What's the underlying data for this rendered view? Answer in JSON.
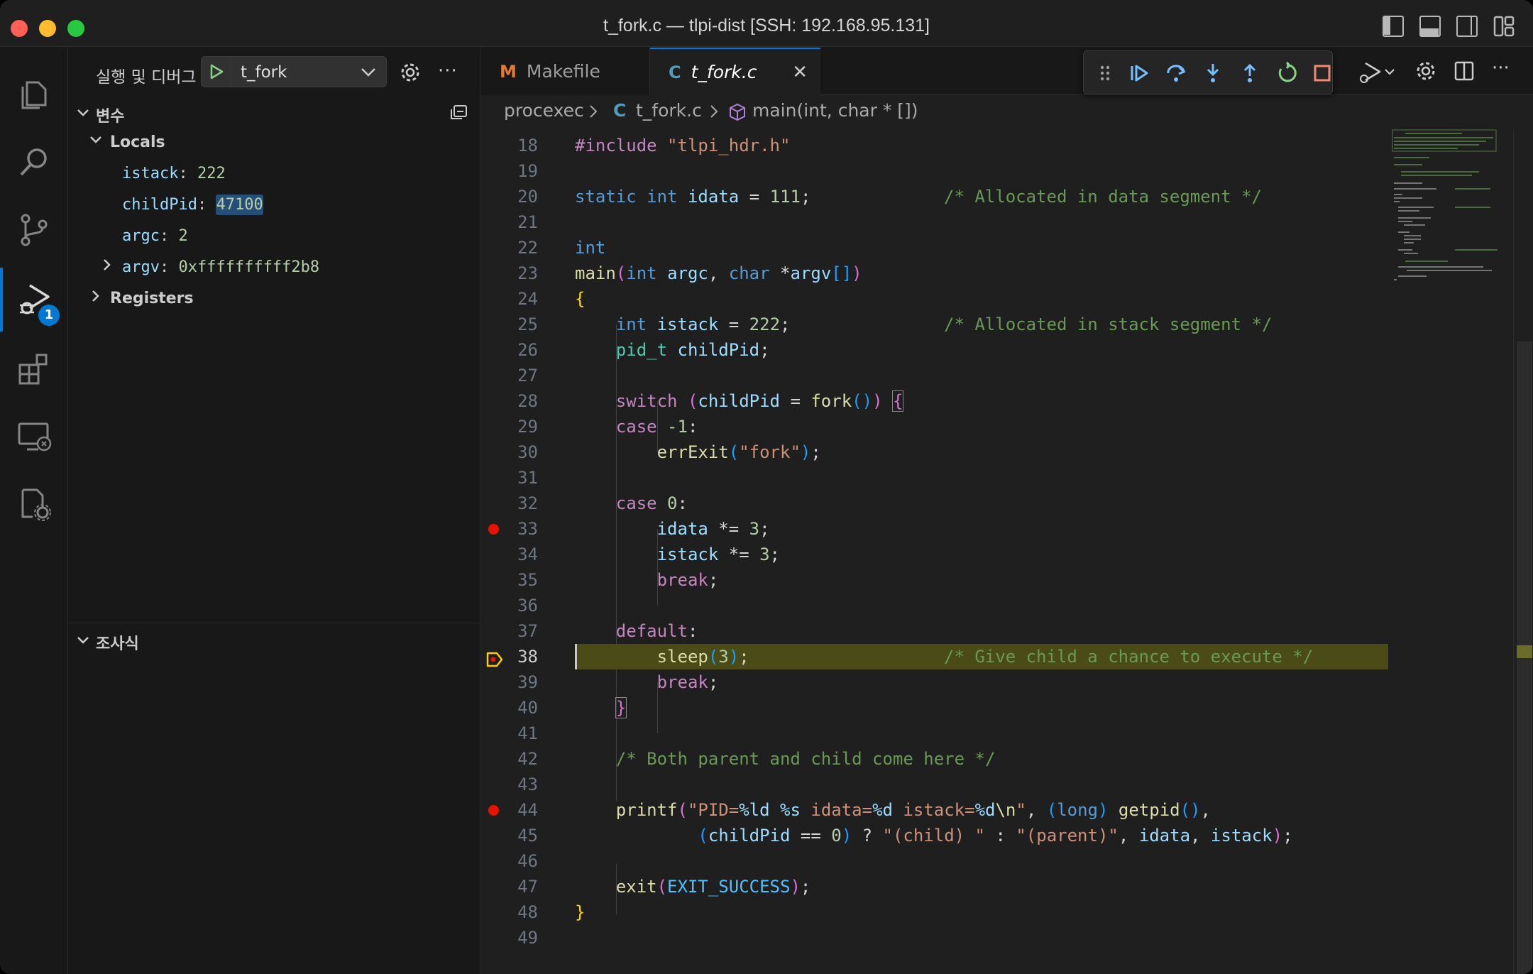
{
  "window": {
    "title": "t_fork.c — tlpi-dist [SSH: 192.168.95.131]"
  },
  "colors": {
    "accent": "#0078d4",
    "breakpoint": "#e51400",
    "current_line": "#4b4b18"
  },
  "activity_bar": {
    "items": [
      {
        "name": "explorer",
        "icon": "files-icon"
      },
      {
        "name": "search",
        "icon": "search-icon"
      },
      {
        "name": "source-control",
        "icon": "source-control-icon"
      },
      {
        "name": "run-and-debug",
        "icon": "debug-icon",
        "badge": "1",
        "active": true
      },
      {
        "name": "extensions",
        "icon": "extensions-icon"
      },
      {
        "name": "remote-explorer",
        "icon": "remote-explorer-icon"
      },
      {
        "name": "remote-settings",
        "icon": "remote-settings-icon"
      }
    ]
  },
  "sidebar": {
    "title": "실행 및 디버그",
    "run_config": "t_fork",
    "more_label": "···",
    "variables": {
      "title": "변수",
      "locals_label": "Locals",
      "locals": [
        {
          "name": "istack",
          "value": "222"
        },
        {
          "name": "childPid",
          "value": "47100"
        },
        {
          "name": "argc",
          "value": "2"
        },
        {
          "name": "argv",
          "value": "0xffffffffff2b8"
        }
      ],
      "registers_label": "Registers"
    },
    "watch": {
      "title": "조사식"
    }
  },
  "editor": {
    "tabs": [
      {
        "icon_label": "M",
        "label": "Makefile"
      },
      {
        "icon_label": "C",
        "label": "t_fork.c",
        "active": true
      }
    ],
    "close_label": "✕",
    "breadcrumbs": {
      "folder": "procexec",
      "file_icon": "C",
      "file": "t_fork.c",
      "symbol": "main(int, char * [])"
    },
    "debug_toolbar": [
      "drag-handle-icon",
      "continue-icon",
      "step-over-icon",
      "step-into-icon",
      "step-out-icon",
      "restart-icon",
      "stop-icon"
    ],
    "current_line": 38,
    "breakpoints": [
      33,
      44
    ],
    "line_numbers": [
      "18",
      "19",
      "20",
      "21",
      "22",
      "23",
      "24",
      "25",
      "26",
      "27",
      "28",
      "29",
      "30",
      "31",
      "32",
      "33",
      "34",
      "35",
      "36",
      "37",
      "38",
      "39",
      "40",
      "41",
      "42",
      "43",
      "44",
      "45",
      "46",
      "47",
      "48",
      "49"
    ],
    "code": {
      "l18_pp": "#include",
      "l18_str": "\"tlpi_hdr.h\"",
      "l20_kw1": "static",
      "l20_kw2": "int",
      "l20_var": "idata",
      "l20_op": " = ",
      "l20_num": "111",
      "l20_semi": ";",
      "l20_cmt": "/* Allocated in data segment */",
      "l22_kw": "int",
      "l23_fn": "main",
      "l23_kw1": "int",
      "l23_v1": "argc",
      "l23_kw2": "char",
      "l23_v2": "argv",
      "l24_brace": "{",
      "l25_kw": "int",
      "l25_var": "istack",
      "l25_num": "222",
      "l25_cmt": "/* Allocated in stack segment */",
      "l26_typ": "pid_t",
      "l26_var": "childPid",
      "l28_ctl": "switch",
      "l28_var": "childPid",
      "l28_fn": "fork",
      "l29_ctl": "case",
      "l29_num": "-1",
      "l30_fn": "errExit",
      "l30_str": "\"fork\"",
      "l32_ctl": "case",
      "l32_num": "0",
      "l33_var": "idata",
      "l33_op": " *= ",
      "l33_num": "3",
      "l34_var": "istack",
      "l34_op": " *= ",
      "l34_num": "3",
      "l35_ctl": "break",
      "l37_ctl": "default",
      "l38_fn": "sleep",
      "l38_num": "3",
      "l38_cmt": "/* Give child a chance to execute */",
      "l39_ctl": "break",
      "l40_brace": "}",
      "l42_cmt": "/* Both parent and child come here */",
      "l44_fn": "printf",
      "l44_s1": "\"PID=",
      "l44_f1": "%ld",
      "l44_s2": " ",
      "l44_f2": "%s",
      "l44_s3": " idata=",
      "l44_f3": "%d",
      "l44_s4": " istack=",
      "l44_f4": "%d",
      "l44_esc": "\\n",
      "l44_s5": "\"",
      "l44_kw": "long",
      "l44_fn2": "getpid",
      "l45_var": "childPid",
      "l45_num": "0",
      "l45_str1": "\"(child) \"",
      "l45_str2": "\"(parent)\"",
      "l45_v2": "idata",
      "l45_v3": "istack",
      "l47_fn": "exit",
      "l47_mac": "EXIT_SUCCESS",
      "l48_brace": "}"
    }
  }
}
